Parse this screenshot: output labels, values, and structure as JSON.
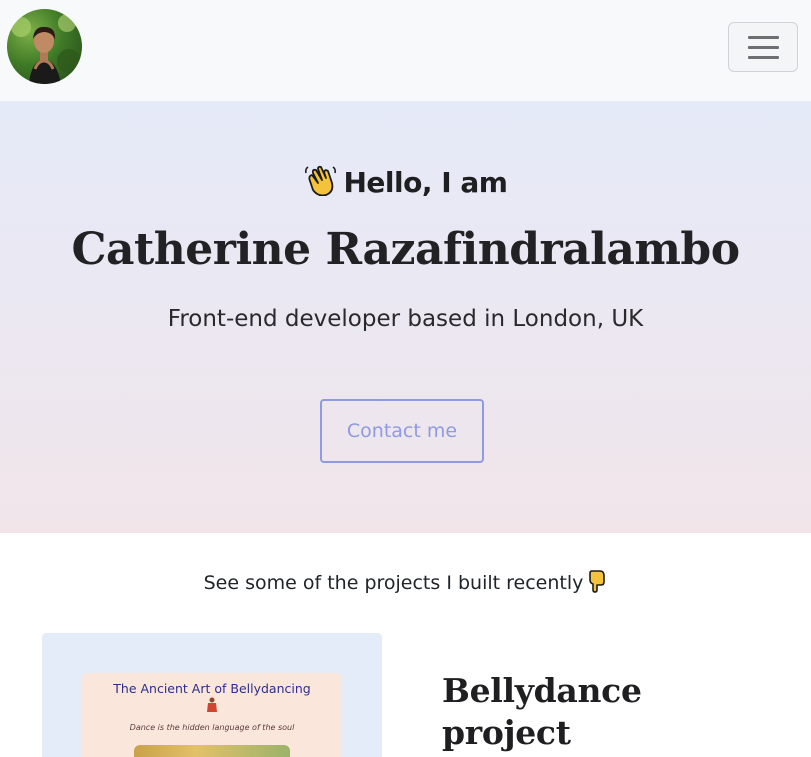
{
  "nav": {
    "avatar_icon": "profile-photo",
    "menu_icon": "hamburger-menu-icon"
  },
  "hero": {
    "greeting": "Hello, I am",
    "greeting_emoji": "waving-hand",
    "name": "Catherine Razafindralambo",
    "tagline": "Front-end developer based in London, UK",
    "contact_label": "Contact me"
  },
  "projects": {
    "intro": "See some of the projects I built recently",
    "intro_emoji": "pointing-down-hand",
    "items": [
      {
        "title": "Bellydance project",
        "thumbnail_title": "The Ancient Art of Bellydancing",
        "thumbnail_subtitle": "Dance is the hidden language of the soul"
      }
    ]
  },
  "colors": {
    "accent": "#8e9be0",
    "hero_top": "#e5eaf8",
    "hero_bottom": "#f1e5ea",
    "navbar_bg": "#f8f9fb",
    "card_bg": "#e4ecfa"
  }
}
